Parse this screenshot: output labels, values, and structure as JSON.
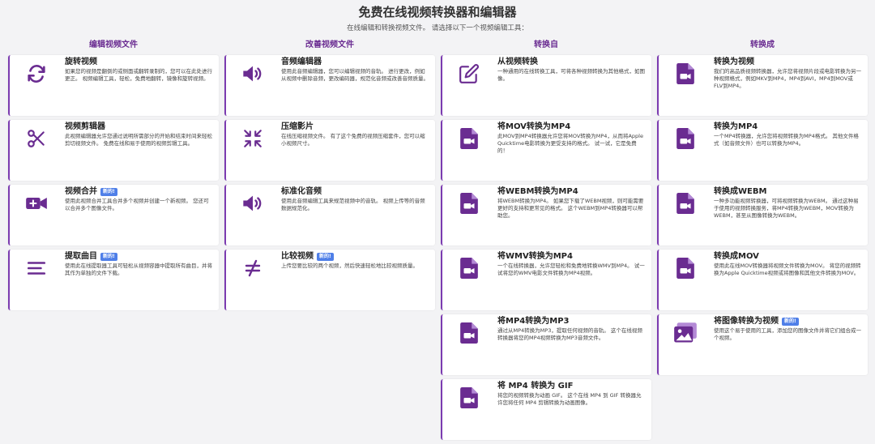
{
  "header": {
    "title": "免费在线视频转换器和编辑器",
    "subtitle": "在线编辑和转换视频文件。 请选择以下一个视频编辑工具："
  },
  "badge_new": "新的!",
  "columns": [
    {
      "heading": "编辑视频文件",
      "cards": [
        {
          "title": "旋转视频",
          "icon": "rotate-icon",
          "desc": "如果您的视频是翻倒的或侧面或翻转录制的，您可以在此处进行更正。 视频编辑工具，轻松，免费地翻转，镜像和旋转视频。"
        },
        {
          "title": "视频剪辑器",
          "icon": "scissors-icon",
          "desc": "此视频编辑器允许您通过说明所需部分的开始和结束时间来轻松剪切视频文件。 免费在线和易于使用的视频剪辑工具。"
        },
        {
          "title": "视频合并",
          "icon": "video-add-icon",
          "badge": true,
          "desc": "使用此视频合并工具合并多个视频并创建一个新视频。 您还可以合并多个图像文件。"
        },
        {
          "title": "提取曲目",
          "icon": "list-icon",
          "badge": true,
          "desc": "使用此在线提取器工具可轻松从视频容器中提取所有曲目，并将其作为单独的文件下载。"
        }
      ]
    },
    {
      "heading": "改善视频文件",
      "cards": [
        {
          "title": "音频编辑器",
          "icon": "speaker-icon",
          "desc": "使用此音频编辑器，您可以编辑视频的音轨。 进行更改，例如从视频中删除音频，更改编码器，规范化音频或改善音频质量。"
        },
        {
          "title": "压缩影片",
          "icon": "compress-icon",
          "desc": "在线压缩视频文件。 有了这个免费的视频压缩套件，您可以缩小视频尺寸。"
        },
        {
          "title": "标准化音频",
          "icon": "speaker-icon",
          "desc": "使用此音频编辑工具来规范视频中的音轨。 视频上传等的音频数据规范化。"
        },
        {
          "title": "比较视频",
          "icon": "not-equal-icon",
          "badge": true,
          "desc": "上传您要比较的两个视频，然后快速轻松地比较视频质量。"
        }
      ]
    },
    {
      "heading": "转换自",
      "cards": [
        {
          "title": "从视频转换",
          "icon": "edit-icon",
          "desc": "一种通用的在线转换工具，可将各种视频转换为其他格式，如图像。"
        },
        {
          "title": "将MOV转换为MP4",
          "icon": "video-file-icon",
          "desc": "此MOV到MP4转换器允许您将MOV转换为MP4，从而将Apple Quicktime电影转换为更受支持的格式。 试一试，它是免费的！"
        },
        {
          "title": "将WEBM转换为MP4",
          "icon": "video-file-icon",
          "desc": "将WEBM转换为MP4。 如果您下载了WEBM视频，则可能需要更好的支持和更常见的格式。 这个WEBM到MP4转换器可以帮助您。"
        },
        {
          "title": "将WMV转换为MP4",
          "icon": "video-file-icon",
          "desc": "一个在线转换器，允许您轻松和免费地转换WMV到MP4。 试一试将您的WMV电影文件转换为MP4视频。"
        },
        {
          "title": "将MP4转换为MP3",
          "icon": "video-file-icon",
          "desc": "通过从MP4转换为MP3，提取任何视频的音轨。 这个在线视频转换器将您的MP4视频转换为MP3音频文件。"
        },
        {
          "title": "将 MP4 转换为 GIF",
          "icon": "video-file-icon",
          "desc": "将您的视频转换为动画 GIF。 这个在线 MP4 到 GIF 转换器允许您将任何 MP4 剪辑转换为动画图像。"
        }
      ]
    },
    {
      "heading": "转换成",
      "cards": [
        {
          "title": "转换为视频",
          "icon": "video-file-icon",
          "desc": "我们的高品质视频转换器，允许您将视频片段或电影转换为另一种视频格式，例如MKV到MP4，MP4到AVI，MP4到MOV或FLV到MP4。"
        },
        {
          "title": "转换为MP4",
          "icon": "video-file-icon",
          "desc": "一个MP4转换器，允许您将视频转换为MP4格式。 其他文件格式（如音频文件）也可以转换为MP4。"
        },
        {
          "title": "转换成WEBM",
          "icon": "video-file-icon",
          "desc": "一种多功能视频转换器，可将视频转换为WEBM。 通过这种易于使用的视频转换服务，将MP4转换为WEBM，MOV转换为WEBM，甚至从图像转换为WEBM。"
        },
        {
          "title": "转换成MOV",
          "icon": "video-file-icon",
          "desc": "使用此在线MOV转换器将视频文件转换为MOV。 将您的视频转换为Apple Quicktime视频或将图像和其他文件转换为MOV。"
        },
        {
          "title": "将图像转换为视频",
          "icon": "images-icon",
          "badge": true,
          "desc": "使用这个易于使用的工具，添加您的图像文件并将它们组合成一个视频。"
        }
      ]
    }
  ],
  "colors": {
    "accent": "#6a2c91",
    "icon": "#6a2c91",
    "badge": "#4f7fe8"
  }
}
